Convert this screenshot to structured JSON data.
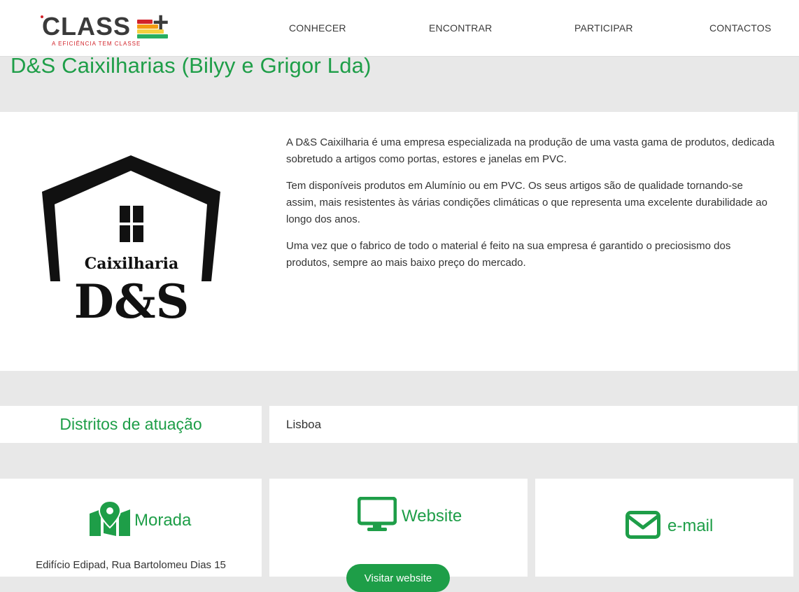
{
  "header": {
    "logo": {
      "word": "CLASS",
      "plus": "+",
      "tagline": "A EFICIÊNCIA TEM CLASSE",
      "bar_colors": [
        "#d2232a",
        "#f39c12",
        "#f4d03f",
        "#27ae60"
      ]
    },
    "nav": [
      "CONHECER",
      "ENCONTRAR",
      "PARTICIPAR",
      "CONTACTOS"
    ]
  },
  "page": {
    "title": "D&S Caixilharias (Bilyy e Grigor Lda)"
  },
  "about": {
    "brand_logo": {
      "line1": "Caixilharia",
      "line2": "D&S"
    },
    "paragraphs": [
      "A D&S Caixilharia é uma empresa especializada na produção de uma vasta gama de produtos, dedicada sobretudo a artigos como portas, estores e janelas em PVC.",
      "Tem disponíveis produtos em Alumínio ou em PVC. Os seus artigos são de qualidade tornando-se assim, mais resistentes às várias condições climáticas o que representa uma excelente durabilidade ao longo dos anos.",
      "Uma vez que o fabrico de todo o material é feito na sua empresa é garantido o preciosismo dos produtos, sempre ao mais baixo preço do mercado."
    ]
  },
  "districts": {
    "label": "Distritos de atuação",
    "value": "Lisboa"
  },
  "cards": {
    "address": {
      "title": "Morada",
      "icon": "map-marker-icon",
      "text": "Edifício Edipad, Rua Bartolomeu Dias 15"
    },
    "website": {
      "title": "Website",
      "icon": "monitor-icon",
      "button_label": "Visitar website"
    },
    "email": {
      "title": "e-mail",
      "icon": "envelope-icon",
      "text": ""
    }
  },
  "colors": {
    "brand_green": "#1e9e48",
    "page_background": "#e8e8e8",
    "panel_background": "#ffffff",
    "text": "#333333"
  }
}
